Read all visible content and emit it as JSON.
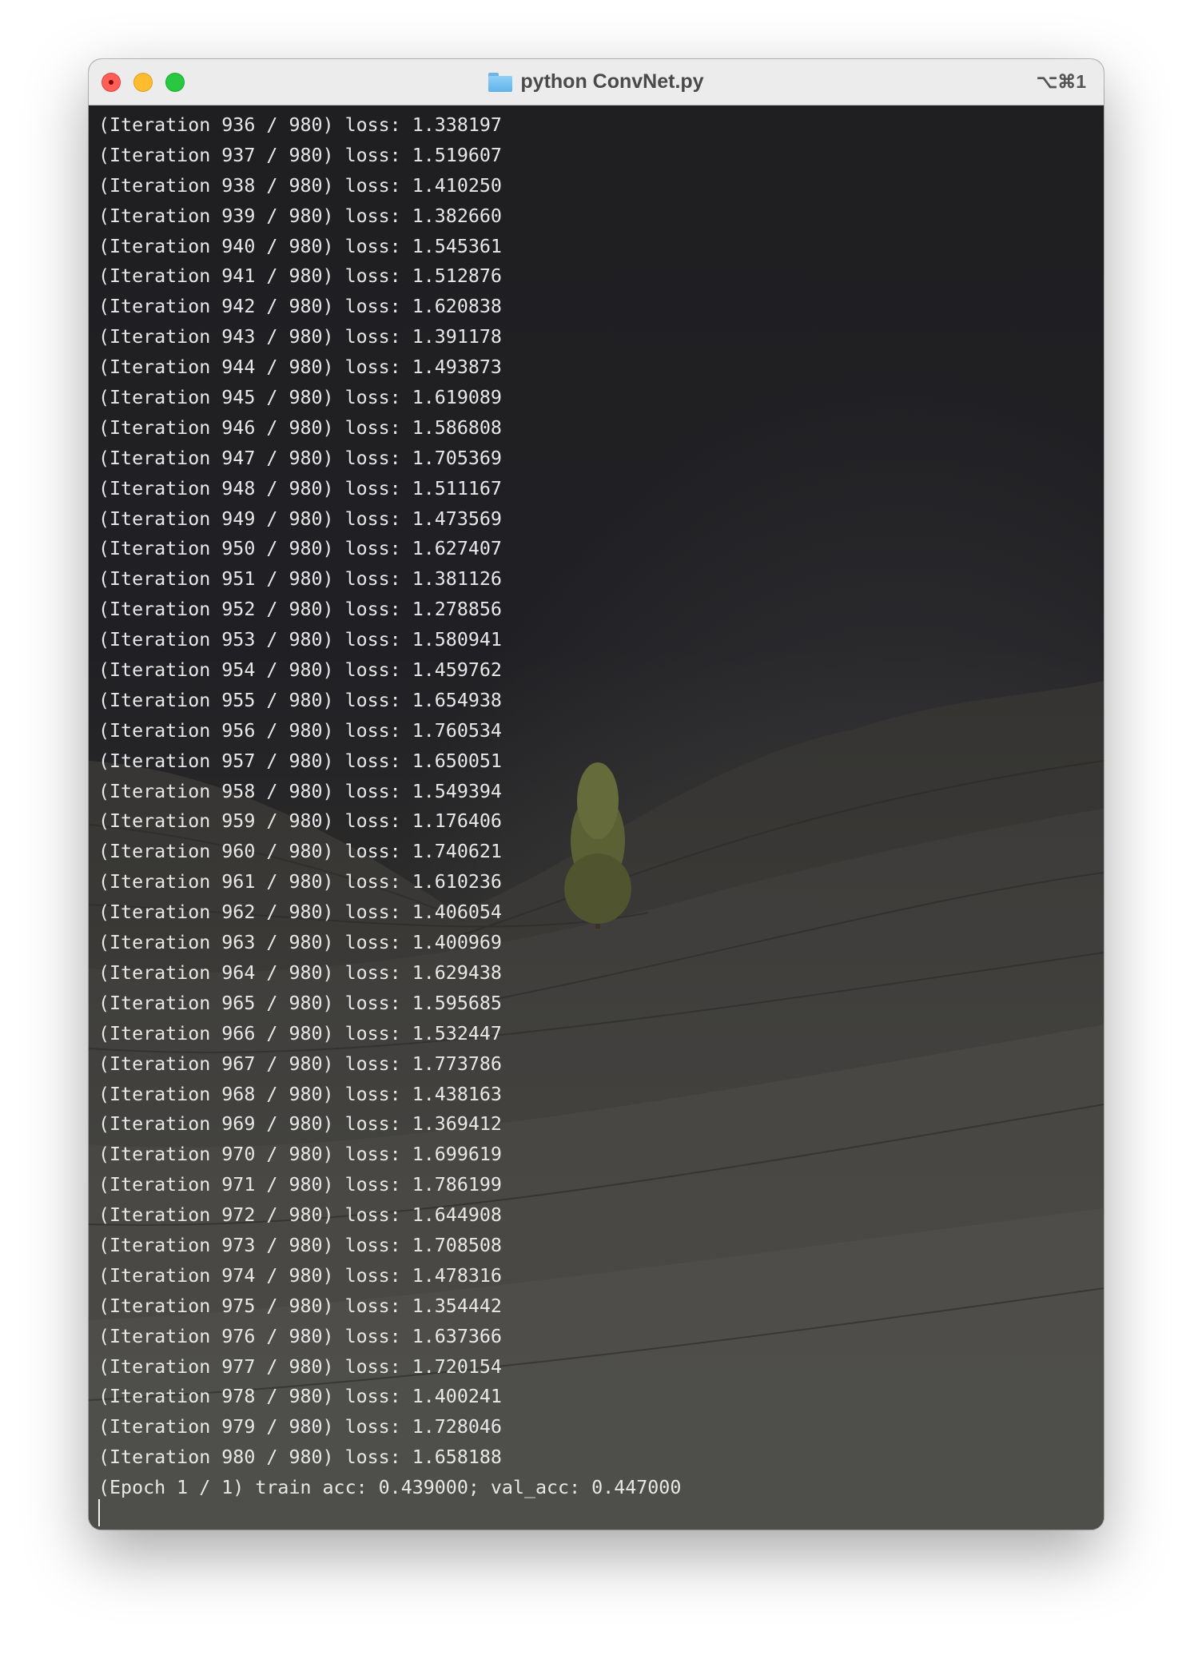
{
  "window": {
    "title": "python ConvNet.py",
    "shortcut": "⌥⌘1",
    "title_icon": "folder-icon"
  },
  "traffic_lights": {
    "close": "#ff5f57",
    "minimize": "#febc2e",
    "maximize": "#28c840"
  },
  "terminal": {
    "lines": [
      "(Iteration 936 / 980) loss: 1.338197",
      "(Iteration 937 / 980) loss: 1.519607",
      "(Iteration 938 / 980) loss: 1.410250",
      "(Iteration 939 / 980) loss: 1.382660",
      "(Iteration 940 / 980) loss: 1.545361",
      "(Iteration 941 / 980) loss: 1.512876",
      "(Iteration 942 / 980) loss: 1.620838",
      "(Iteration 943 / 980) loss: 1.391178",
      "(Iteration 944 / 980) loss: 1.493873",
      "(Iteration 945 / 980) loss: 1.619089",
      "(Iteration 946 / 980) loss: 1.586808",
      "(Iteration 947 / 980) loss: 1.705369",
      "(Iteration 948 / 980) loss: 1.511167",
      "(Iteration 949 / 980) loss: 1.473569",
      "(Iteration 950 / 980) loss: 1.627407",
      "(Iteration 951 / 980) loss: 1.381126",
      "(Iteration 952 / 980) loss: 1.278856",
      "(Iteration 953 / 980) loss: 1.580941",
      "(Iteration 954 / 980) loss: 1.459762",
      "(Iteration 955 / 980) loss: 1.654938",
      "(Iteration 956 / 980) loss: 1.760534",
      "(Iteration 957 / 980) loss: 1.650051",
      "(Iteration 958 / 980) loss: 1.549394",
      "(Iteration 959 / 980) loss: 1.176406",
      "(Iteration 960 / 980) loss: 1.740621",
      "(Iteration 961 / 980) loss: 1.610236",
      "(Iteration 962 / 980) loss: 1.406054",
      "(Iteration 963 / 980) loss: 1.400969",
      "(Iteration 964 / 980) loss: 1.629438",
      "(Iteration 965 / 980) loss: 1.595685",
      "(Iteration 966 / 980) loss: 1.532447",
      "(Iteration 967 / 980) loss: 1.773786",
      "(Iteration 968 / 980) loss: 1.438163",
      "(Iteration 969 / 980) loss: 1.369412",
      "(Iteration 970 / 980) loss: 1.699619",
      "(Iteration 971 / 980) loss: 1.786199",
      "(Iteration 972 / 980) loss: 1.644908",
      "(Iteration 973 / 980) loss: 1.708508",
      "(Iteration 974 / 980) loss: 1.478316",
      "(Iteration 975 / 980) loss: 1.354442",
      "(Iteration 976 / 980) loss: 1.637366",
      "(Iteration 977 / 980) loss: 1.720154",
      "(Iteration 978 / 980) loss: 1.400241",
      "(Iteration 979 / 980) loss: 1.728046",
      "(Iteration 980 / 980) loss: 1.658188",
      "(Epoch 1 / 1) train acc: 0.439000; val_acc: 0.447000"
    ]
  }
}
